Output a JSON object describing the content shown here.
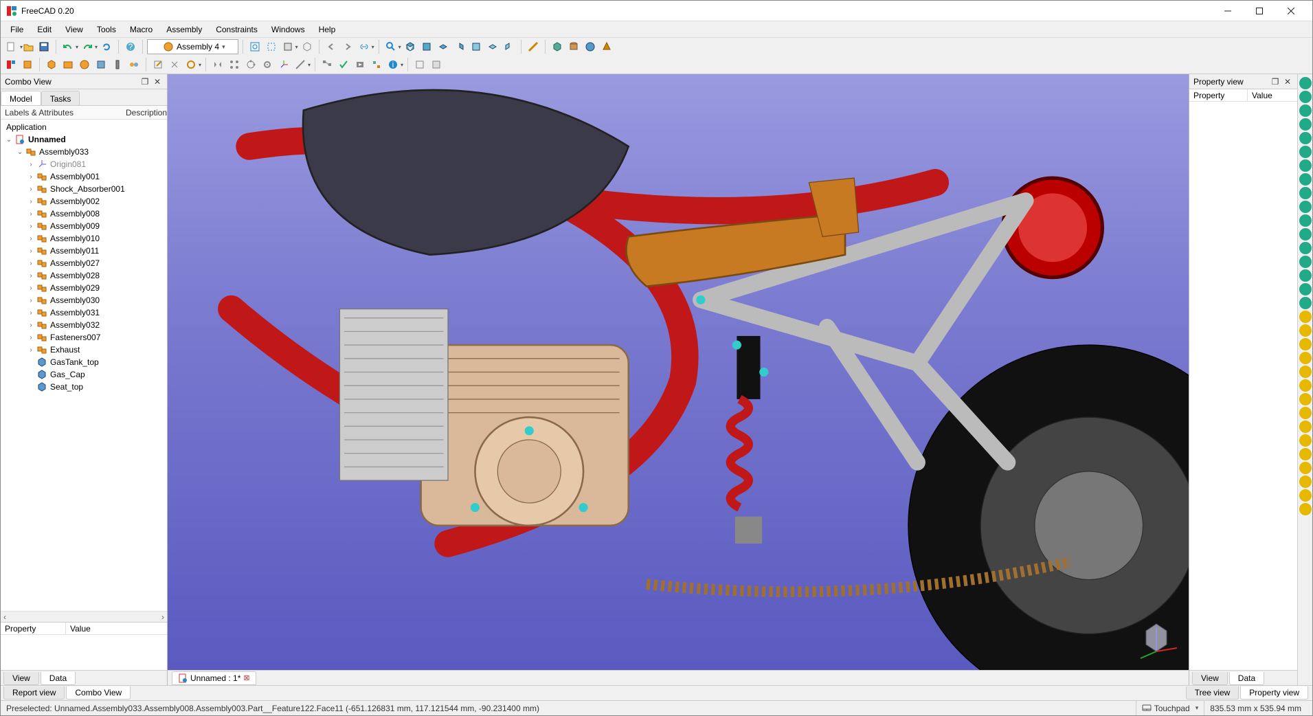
{
  "app_title": "FreeCAD 0.20",
  "menu": [
    "File",
    "Edit",
    "View",
    "Tools",
    "Macro",
    "Assembly",
    "Constraints",
    "Windows",
    "Help"
  ],
  "workbench_selected": "Assembly 4",
  "combo": {
    "title": "Combo View",
    "tabs": [
      "Model",
      "Tasks"
    ],
    "active_tab": 0,
    "tree_header": {
      "col1": "Labels & Attributes",
      "col2": "Description"
    },
    "application_label": "Application",
    "root_doc": "Unnamed",
    "assembly_root": "Assembly033",
    "origin": "Origin081",
    "assemblies": [
      "Assembly001",
      "Shock_Absorber001",
      "Assembly002",
      "Assembly008",
      "Assembly009",
      "Assembly010",
      "Assembly011",
      "Assembly027",
      "Assembly028",
      "Assembly029",
      "Assembly030",
      "Assembly031",
      "Assembly032",
      "Fasteners007",
      "Exhaust"
    ],
    "parts": [
      "GasTank_top",
      "Gas_Cap",
      "Seat_top"
    ],
    "prop_header": {
      "c1": "Property",
      "c2": "Value"
    },
    "bottom_tabs": [
      "View",
      "Data"
    ],
    "bottom_active": 1
  },
  "viewport": {
    "doc_tab": "Unnamed : 1*"
  },
  "prop_panel": {
    "title": "Property view",
    "header": {
      "c1": "Property",
      "c2": "Value"
    },
    "bottom_tabs": [
      "View",
      "Data"
    ],
    "bottom_active": 1
  },
  "footer": {
    "left_tabs": [
      "Report view",
      "Combo View"
    ],
    "right_tabs": [
      "Tree view",
      "Property view"
    ]
  },
  "status": {
    "preselected": "Preselected: Unnamed.Assembly033.Assembly008.Assembly003.Part__Feature122.Face11 (-651.126831 mm, 117.121544 mm, -90.231400 mm)",
    "nav_style": "Touchpad",
    "dimensions": "835.53 mm x 535.94 mm"
  },
  "right_gutter_icons": 32
}
